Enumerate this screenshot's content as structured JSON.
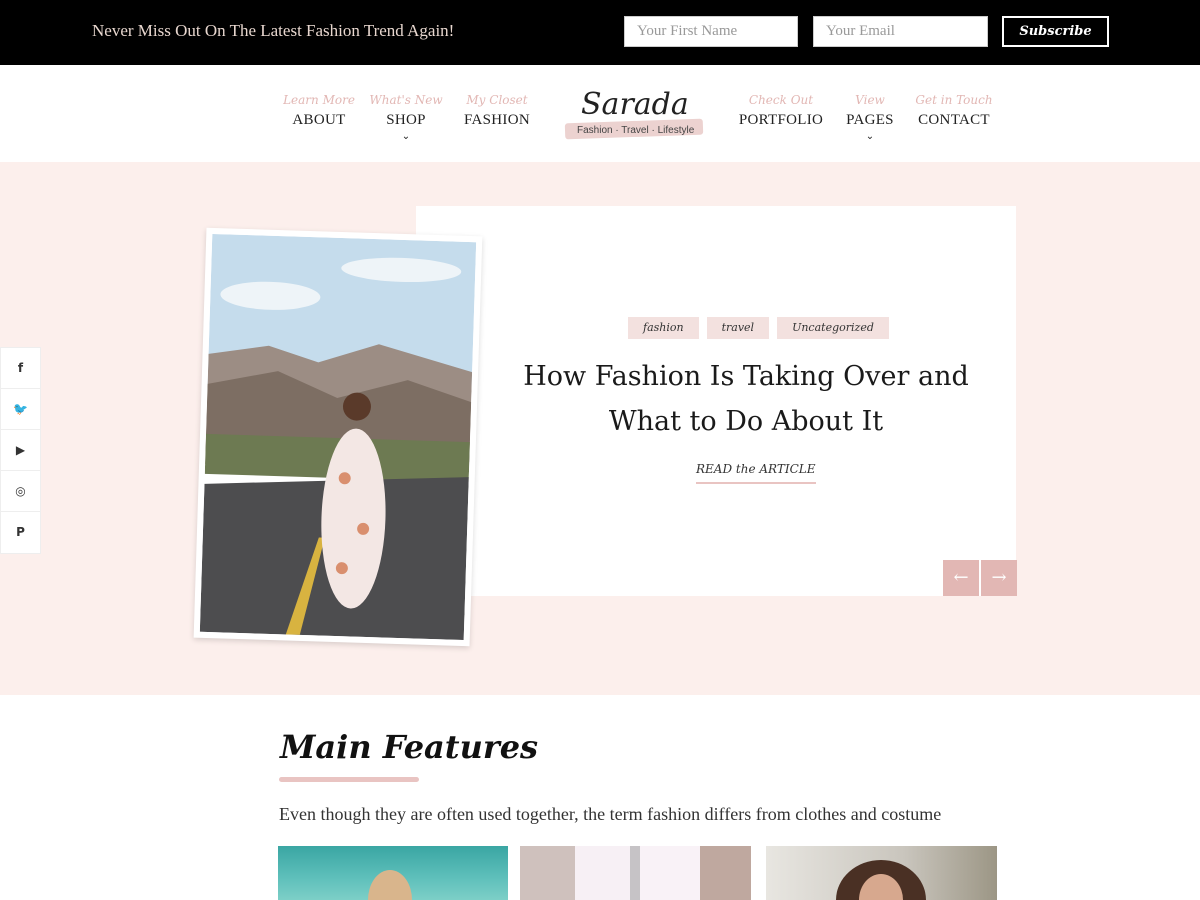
{
  "topbar": {
    "message": "Never Miss Out On The Latest Fashion Trend Again!",
    "first_name_placeholder": "Your First Name",
    "email_placeholder": "Your Email",
    "subscribe_label": "Subscribe"
  },
  "nav": {
    "items": [
      {
        "sub": "Learn More",
        "label": "ABOUT"
      },
      {
        "sub": "What's New",
        "label": "SHOP",
        "has_dropdown": true
      },
      {
        "sub": "My Closet",
        "label": "FASHION"
      },
      {
        "sub": "Check Out",
        "label": "PORTFOLIO"
      },
      {
        "sub": "View",
        "label": "PAGES",
        "has_dropdown": true
      },
      {
        "sub": "Get in Touch",
        "label": "CONTACT"
      }
    ],
    "chevron": "⌄"
  },
  "logo": {
    "name": "Sarada",
    "tagline": "Fashion · Travel · Lifestyle"
  },
  "hero": {
    "tags": [
      "fashion",
      "travel",
      "Uncategorized"
    ],
    "title_line1": "How Fashion Is Taking Over and",
    "title_line2": "What to Do About It",
    "read_more": "READ the ARTICLE",
    "prev_arrow": "←",
    "next_arrow": "→"
  },
  "social": {
    "items": [
      {
        "icon": "facebook-icon",
        "glyph": "f"
      },
      {
        "icon": "twitter-icon",
        "glyph": "🐦"
      },
      {
        "icon": "youtube-icon",
        "glyph": "▶"
      },
      {
        "icon": "instagram-icon",
        "glyph": "◎"
      },
      {
        "icon": "pinterest-icon",
        "glyph": "P"
      }
    ]
  },
  "features": {
    "title": "Main Features",
    "description": "Even though they are often used together, the term fashion differs from clothes and costume"
  },
  "colors": {
    "accent_pink": "#e2b7b4",
    "hero_bg": "#fcefec",
    "topbar_bg": "#000000"
  }
}
